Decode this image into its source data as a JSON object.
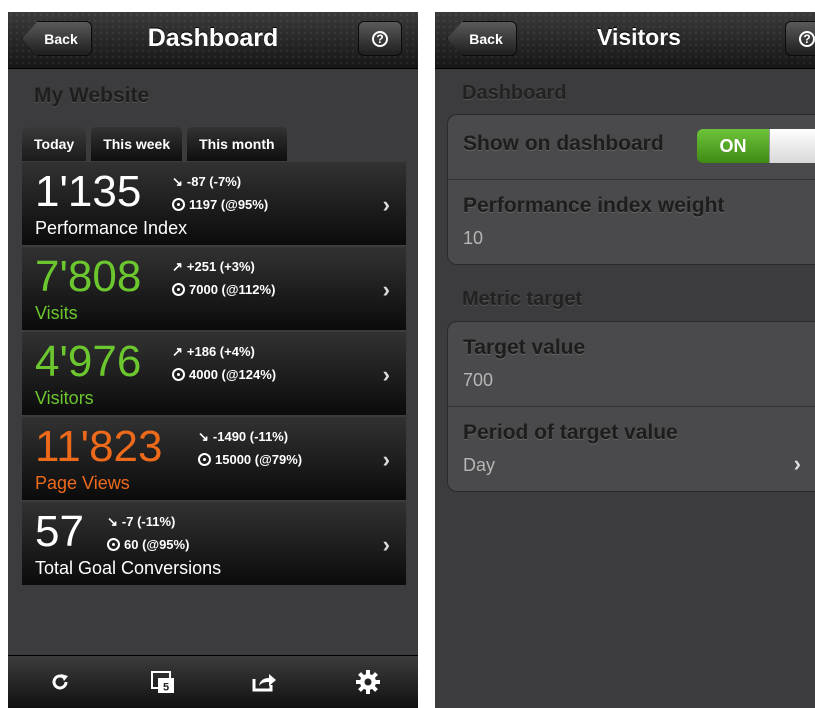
{
  "dashboard": {
    "back_label": "Back",
    "title": "Dashboard",
    "help_label": "?",
    "site_title": "My Website",
    "tabs": [
      {
        "label": "Today"
      },
      {
        "label": "This week"
      },
      {
        "label": "This month"
      }
    ],
    "metrics": [
      {
        "value": "1'135",
        "name": "Performance Index",
        "change": "-87 (-7%)",
        "trend": "down",
        "target": "1197 (@95%)",
        "color": "#ffffff"
      },
      {
        "value": "7'808",
        "name": "Visits",
        "change": "+251 (+3%)",
        "trend": "up",
        "target": "7000 (@112%)",
        "color": "#6cc72f"
      },
      {
        "value": "4'976",
        "name": "Visitors",
        "change": "+186 (+4%)",
        "trend": "up",
        "target": "4000 (@124%)",
        "color": "#6cc72f"
      },
      {
        "value": "11'823",
        "name": "Page Views",
        "change": "-1490 (-11%)",
        "trend": "down",
        "target": "15000 (@79%)",
        "color": "#ee6a1b"
      },
      {
        "value": "57",
        "name": "Total Goal Conversions",
        "change": "-7 (-11%)",
        "trend": "down",
        "target": "60 (@95%)",
        "color": "#ffffff"
      }
    ],
    "toolbar": {
      "refresh_icon": "refresh-icon",
      "calendar_icon": "calendar-icon",
      "calendar_day": "5",
      "share_icon": "share-icon",
      "settings_icon": "gear-icon"
    }
  },
  "visitors": {
    "back_label": "Back",
    "title": "Visitors",
    "help_label": "?",
    "section_dashboard": "Dashboard",
    "show_on_dashboard_label": "Show on dashboard",
    "toggle_state": "ON",
    "perf_weight_label": "Performance index weight",
    "perf_weight_value": "10",
    "section_metric_target": "Metric target",
    "target_value_label": "Target value",
    "target_value": "700",
    "period_label": "Period of target value",
    "period_value": "Day"
  }
}
